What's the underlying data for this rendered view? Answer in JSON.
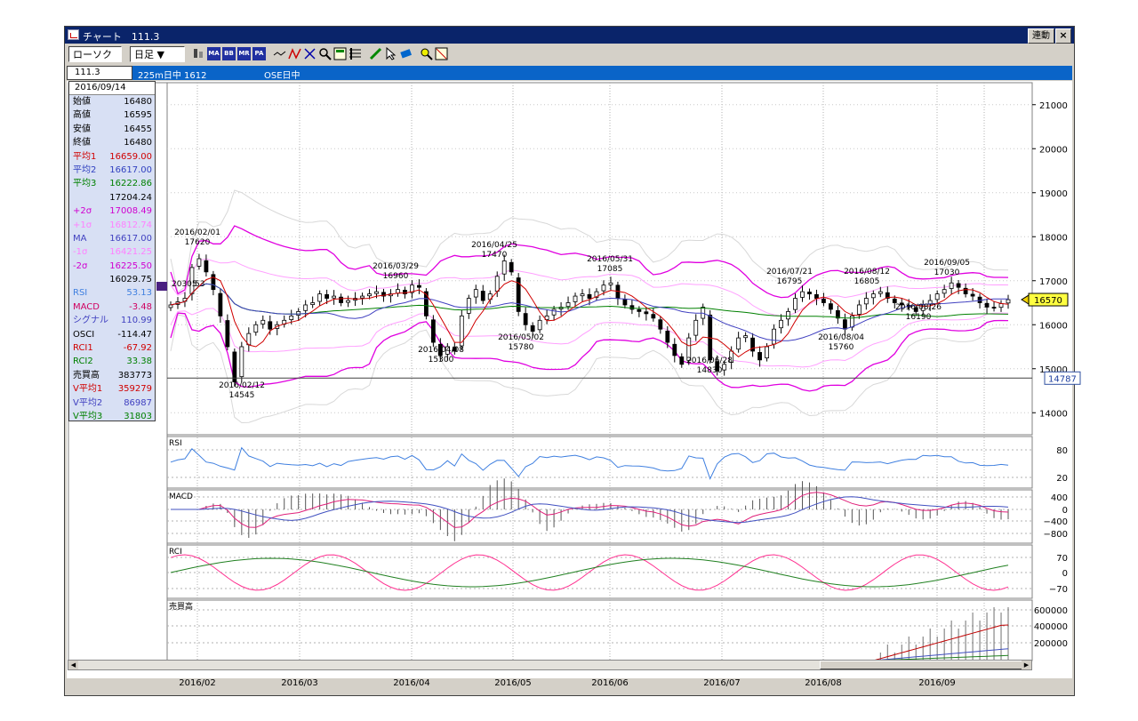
{
  "window": {
    "title": "チャート　111.3",
    "link_button": "連動",
    "close_button": "×"
  },
  "toolbar": {
    "candle_dropdown": "ローソク ▼",
    "period_dropdown": "日足 ▼",
    "icons": [
      "chart-type-icon",
      "ma-icon",
      "bb-icon",
      "mr-icon",
      "pa-icon",
      "line-icon",
      "zigzag-icon",
      "cross-icon",
      "zoom-icon",
      "calc-icon",
      "fibo-icon",
      "pen-icon",
      "cursor-icon",
      "erase-icon",
      "search-icon",
      "clear-icon"
    ]
  },
  "infobar": {
    "symbol": "111.3",
    "contract": "225m日中 1612",
    "market": "OSE日中"
  },
  "data_panel": {
    "date": "2016/09/14",
    "rows": [
      {
        "label": "始値",
        "value": "16480",
        "color": "#000000"
      },
      {
        "label": "高値",
        "value": "16595",
        "color": "#000000"
      },
      {
        "label": "安値",
        "value": "16455",
        "color": "#000000"
      },
      {
        "label": "終値",
        "value": "16480",
        "color": "#000000"
      },
      {
        "label": "平均1",
        "value": "16659.00",
        "color": "#d00000"
      },
      {
        "label": "平均2",
        "value": "16617.00",
        "color": "#3040c0"
      },
      {
        "label": "平均3",
        "value": "16222.86",
        "color": "#008000"
      },
      {
        "label": "",
        "value": "17204.24",
        "color": "#000000"
      },
      {
        "label": "+2σ",
        "value": "17008.49",
        "color": "#d000d0"
      },
      {
        "label": "+1σ",
        "value": "16812.74",
        "color": "#ff80ff"
      },
      {
        "label": "MA",
        "value": "16617.00",
        "color": "#4040c0"
      },
      {
        "label": "-1σ",
        "value": "16421.25",
        "color": "#ff80ff"
      },
      {
        "label": "-2σ",
        "value": "16225.50",
        "color": "#d000d0"
      },
      {
        "label": "",
        "value": "16029.75",
        "color": "#000000"
      },
      {
        "label": "RSI",
        "value": "53.13",
        "color": "#4080e0"
      },
      {
        "label": "MACD",
        "value": "-3.48",
        "color": "#d00060"
      },
      {
        "label": "シグナル",
        "value": "110.99",
        "color": "#4040c0"
      },
      {
        "label": "OSCI",
        "value": "-114.47",
        "color": "#000000"
      },
      {
        "label": "RCI1",
        "value": "-67.92",
        "color": "#d00000"
      },
      {
        "label": "RCI2",
        "value": "33.38",
        "color": "#008000"
      },
      {
        "label": "売買高",
        "value": "383773",
        "color": "#000000"
      },
      {
        "label": "V平均1",
        "value": "359279",
        "color": "#d00000"
      },
      {
        "label": "V平均2",
        "value": "86987",
        "color": "#4040c0"
      },
      {
        "label": "V平均3",
        "value": "31803",
        "color": "#008000"
      }
    ]
  },
  "price_axis": {
    "ticks": [
      "21000",
      "20000",
      "19000",
      "18000",
      "17000",
      "16000",
      "15000",
      "14000"
    ],
    "current_price": "16570",
    "horizontal_line": "14787"
  },
  "annotations": [
    {
      "date": "2016/02/01",
      "value": "17620"
    },
    {
      "date": "2016/02/12",
      "value": "14545"
    },
    {
      "date": "2016/03/29",
      "value": "16960"
    },
    {
      "date": "2016/04/08",
      "value": "15300"
    },
    {
      "date": "2016/04/25",
      "value": "17470"
    },
    {
      "date": "2016/05/02",
      "value": "15780"
    },
    {
      "date": "2016/05/31",
      "value": "17085"
    },
    {
      "date": "2016/06/28",
      "value": "14830"
    },
    {
      "date": "2016/07/21",
      "value": "16795"
    },
    {
      "date": "2016/08/04",
      "value": "15760"
    },
    {
      "date": "2016/08/12",
      "value": "16805"
    },
    {
      "date": "2016/08/26",
      "value": "16190"
    },
    {
      "date": "2016/09/05",
      "value": "17030"
    }
  ],
  "start_label": "20305",
  "start_label_tail": "53",
  "sub_panels": {
    "rsi": {
      "label": "RSI",
      "ticks": [
        "80",
        "20"
      ]
    },
    "macd": {
      "label": "MACD",
      "ticks": [
        "400",
        "0",
        "−400",
        "−800"
      ]
    },
    "rci": {
      "label": "RCI",
      "ticks": [
        "70",
        "0",
        "−70"
      ]
    },
    "volume": {
      "label": "売買高",
      "ticks": [
        "600000",
        "400000",
        "200000"
      ]
    }
  },
  "x_axis_labels": [
    "2016/02",
    "2016/03",
    "2016/04",
    "2016/05",
    "2016/06",
    "2016/07",
    "2016/08",
    "2016/09"
  ],
  "chart_data": {
    "type": "line",
    "ylim": [
      13500,
      21500
    ],
    "closes": [
      16450,
      16520,
      16600,
      17300,
      17500,
      17200,
      16800,
      16200,
      15500,
      14700,
      15500,
      15800,
      16000,
      16100,
      15900,
      16000,
      16100,
      16200,
      16300,
      16450,
      16500,
      16700,
      16600,
      16650,
      16500,
      16550,
      16600,
      16650,
      16700,
      16750,
      16650,
      16700,
      16800,
      16700,
      16900,
      16850,
      16200,
      15600,
      15300,
      15500,
      15400,
      16200,
      16600,
      16800,
      16550,
      16700,
      17100,
      17450,
      17200,
      16300,
      16000,
      15850,
      16100,
      16200,
      16350,
      16400,
      16500,
      16650,
      16700,
      16600,
      16750,
      16900,
      16950,
      16600,
      16450,
      16350,
      16300,
      16250,
      16150,
      15900,
      15600,
      15300,
      15100,
      15700,
      16100,
      16400,
      15200,
      14950,
      15100,
      15400,
      15700,
      15750,
      15400,
      15200,
      15500,
      15900,
      16100,
      16300,
      16600,
      16750,
      16700,
      16600,
      16500,
      16350,
      16150,
      15900,
      16200,
      16450,
      16600,
      16700,
      16750,
      16600,
      16500,
      16450,
      16400,
      16300,
      16450,
      16550,
      16700,
      16800,
      16950,
      16850,
      16700,
      16650,
      16500,
      16400,
      16380,
      16480,
      16570
    ]
  }
}
